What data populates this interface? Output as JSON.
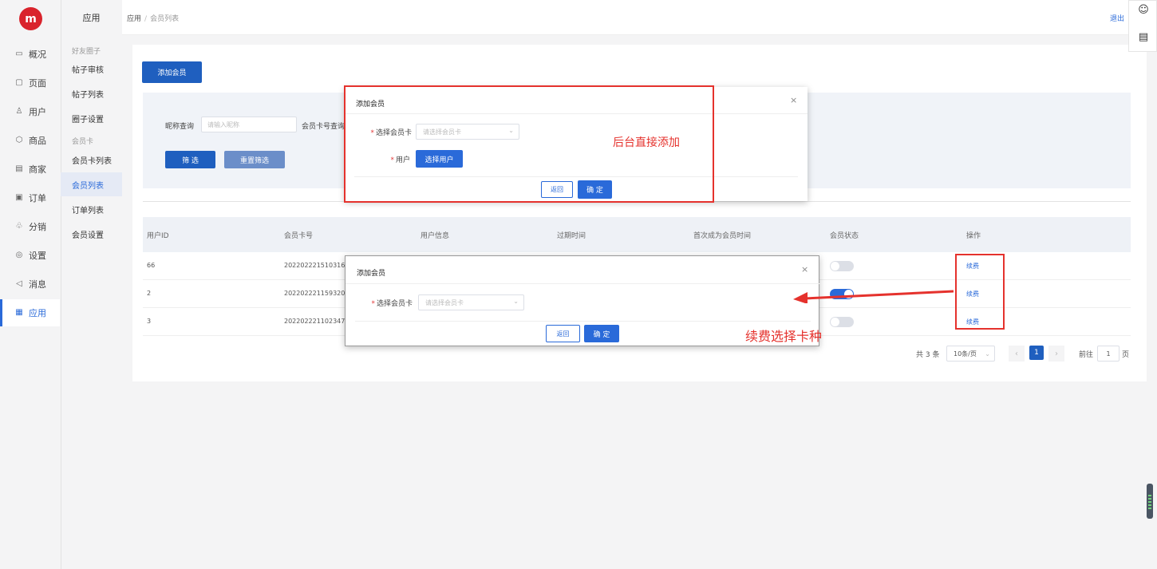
{
  "sidebar": {
    "logo_text": "m",
    "items": [
      {
        "icon": "monitor-icon",
        "glyph": "▭",
        "label": "概况"
      },
      {
        "icon": "page-icon",
        "glyph": "▢",
        "label": "页面"
      },
      {
        "icon": "user-icon",
        "glyph": "♙",
        "label": "用户"
      },
      {
        "icon": "product-icon",
        "glyph": "⬡",
        "label": "商品"
      },
      {
        "icon": "store-icon",
        "glyph": "▤",
        "label": "商家"
      },
      {
        "icon": "order-icon",
        "glyph": "▣",
        "label": "订单"
      },
      {
        "icon": "distribution-icon",
        "glyph": "♧",
        "label": "分销"
      },
      {
        "icon": "settings-icon",
        "glyph": "◎",
        "label": "设置"
      },
      {
        "icon": "message-icon",
        "glyph": "◁",
        "label": "消息"
      },
      {
        "icon": "apps-icon",
        "glyph": "▦",
        "label": "应用"
      }
    ]
  },
  "subbar": {
    "title": "应用",
    "group1": "好友圈子",
    "group1_items": [
      "帖子审核",
      "帖子列表",
      "圈子设置"
    ],
    "group2": "会员卡",
    "group2_items": [
      "会员卡列表",
      "会员列表",
      "订单列表",
      "会员设置"
    ]
  },
  "topbar": {
    "crumb1": "应用",
    "crumb_sep": "/",
    "crumb2": "会员列表",
    "logout": "退出"
  },
  "toolbar": {
    "add_member": "添加会员"
  },
  "filters": {
    "nickname_label": "昵称查询",
    "nickname_placeholder": "请输入昵称",
    "card_no_label": "会员卡号查询",
    "filter_btn": "筛 选",
    "reset_btn": "重置筛选"
  },
  "table": {
    "headers": [
      "用户ID",
      "会员卡号",
      "用户信息",
      "过期时间",
      "首次成为会员时间",
      "会员状态",
      "操作"
    ],
    "rows": [
      {
        "id": "66",
        "card": "202202221510316",
        "status_on": false,
        "action": "续费"
      },
      {
        "id": "2",
        "card": "202202221159320",
        "status_on": true,
        "action": "续费"
      },
      {
        "id": "3",
        "card": "202202221102347",
        "status_on": false,
        "action": "续费"
      }
    ]
  },
  "pagination": {
    "total": "共 3 条",
    "page_size": "10条/页",
    "prev": "‹",
    "current": "1",
    "next": "›",
    "goto_label": "前往",
    "goto_value": "1",
    "page_suffix": "页"
  },
  "dialog_add": {
    "title": "添加会员",
    "close": "×",
    "card_label": "选择会员卡",
    "card_placeholder": "请选择会员卡",
    "user_label": "用户",
    "select_user_btn": "选择用户",
    "back_btn": "返回",
    "confirm_btn": "确 定"
  },
  "dialog_renew": {
    "title": "添加会员",
    "close": "×",
    "card_label": "选择会员卡",
    "card_placeholder": "请选择会员卡",
    "back_btn": "返回",
    "confirm_btn": "确 定"
  },
  "annotations": {
    "add_note": "后台直接添加",
    "renew_note": "续费选择卡种",
    "color": "#e5322d"
  },
  "right_tools": {
    "smile": "smile-icon",
    "layout": "layout-icon"
  },
  "colors": {
    "primary": "#1f5fbf",
    "link": "#2a6ad9",
    "logo": "#d9232c"
  }
}
